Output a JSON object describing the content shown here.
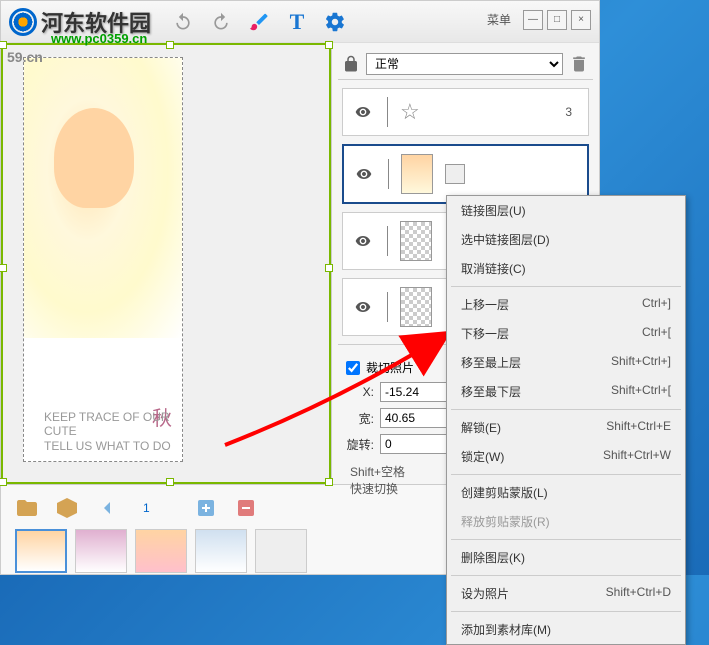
{
  "titlebar": {
    "logo_text": "河东软件园",
    "url": "www.pc0359.cn",
    "menu_label": "菜单"
  },
  "layers": {
    "blend_mode": "正常",
    "items": [
      {
        "num": "3",
        "type": "star"
      },
      {
        "num": "",
        "type": "photo"
      },
      {
        "num": "",
        "type": "checker"
      },
      {
        "num": "",
        "type": "checker"
      }
    ]
  },
  "props": {
    "crop_label": "裁切照片",
    "x_label": "X:",
    "x_value": "-15.24",
    "w_label": "宽:",
    "w_value": "40.65",
    "rotate_label": "旋转:",
    "rotate_value": "0",
    "hint_line1": "Shift+空格",
    "hint_line2": "快速切换"
  },
  "bottom": {
    "page": "1"
  },
  "canvas": {
    "watermark_corner": "59.cn",
    "deco_text": "秋",
    "small_text1": "KEEP TRACE OF OUR CUTE",
    "small_text2": "TELL US WHAT TO DO"
  },
  "context_menu": {
    "items": [
      {
        "label": "链接图层(U)",
        "shortcut": "",
        "disabled": false
      },
      {
        "label": "选中链接图层(D)",
        "shortcut": "",
        "disabled": false
      },
      {
        "label": "取消链接(C)",
        "shortcut": "",
        "disabled": false
      },
      {
        "sep": true
      },
      {
        "label": "上移一层",
        "shortcut": "Ctrl+]",
        "disabled": false
      },
      {
        "label": "下移一层",
        "shortcut": "Ctrl+[",
        "disabled": false
      },
      {
        "label": "移至最上层",
        "shortcut": "Shift+Ctrl+]",
        "disabled": false
      },
      {
        "label": "移至最下层",
        "shortcut": "Shift+Ctrl+[",
        "disabled": false
      },
      {
        "sep": true
      },
      {
        "label": "解锁(E)",
        "shortcut": "Shift+Ctrl+E",
        "disabled": false
      },
      {
        "label": "锁定(W)",
        "shortcut": "Shift+Ctrl+W",
        "disabled": false
      },
      {
        "sep": true
      },
      {
        "label": "创建剪贴蒙版(L)",
        "shortcut": "",
        "disabled": false
      },
      {
        "label": "释放剪贴蒙版(R)",
        "shortcut": "",
        "disabled": true
      },
      {
        "sep": true
      },
      {
        "label": "删除图层(K)",
        "shortcut": "",
        "disabled": false
      },
      {
        "sep": true
      },
      {
        "label": "设为照片",
        "shortcut": "Shift+Ctrl+D",
        "disabled": false
      },
      {
        "sep": true
      },
      {
        "label": "添加到素材库(M)",
        "shortcut": "",
        "disabled": false
      }
    ]
  }
}
